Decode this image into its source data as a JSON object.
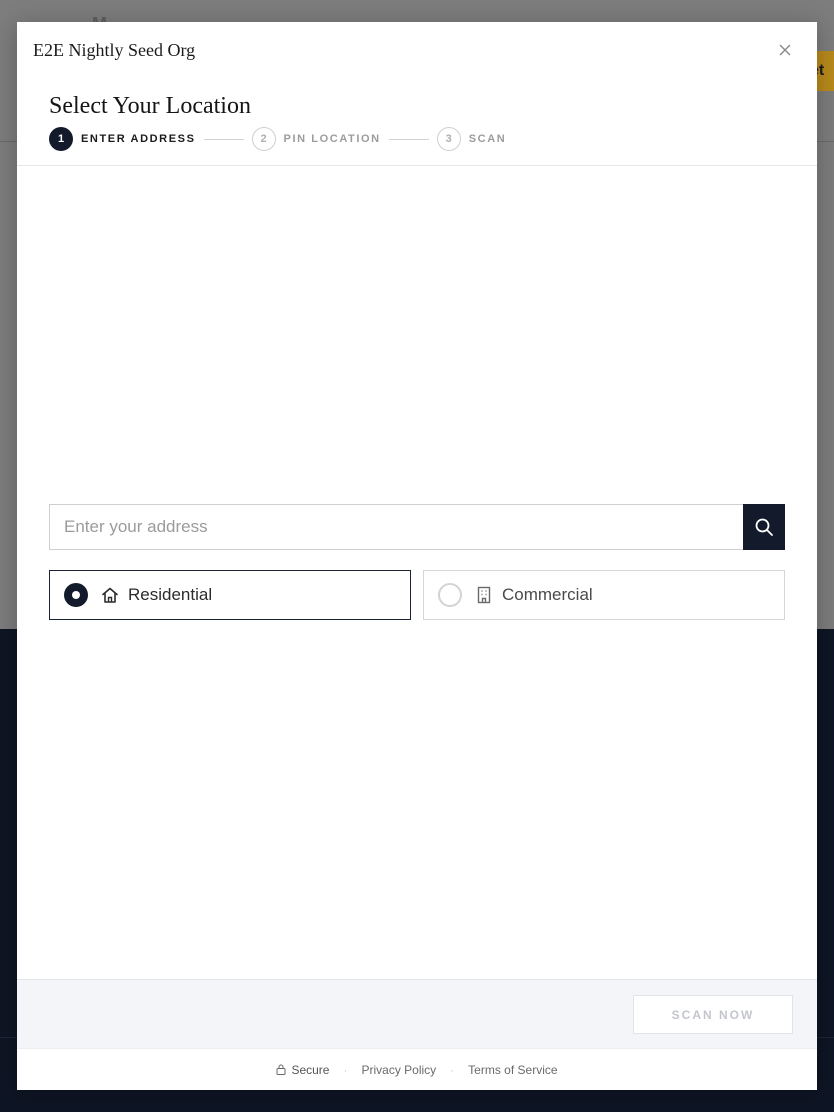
{
  "background": {
    "logo_text": "M",
    "cta_text": "et"
  },
  "modal": {
    "title": "E2E Nightly Seed Org",
    "close_icon": "close-icon",
    "section_title": "Select Your Location",
    "steps": [
      {
        "number": "1",
        "label": "Enter Address",
        "state": "active"
      },
      {
        "number": "2",
        "label": "Pin Location",
        "state": "inactive"
      },
      {
        "number": "3",
        "label": "Scan",
        "state": "inactive"
      }
    ],
    "address": {
      "value": "",
      "placeholder": "Enter your address",
      "search_icon": "search-icon"
    },
    "property_types": [
      {
        "label": "Residential",
        "icon": "home-icon",
        "selected": true
      },
      {
        "label": "Commercial",
        "icon": "building-icon",
        "selected": false
      }
    ],
    "scan_button": "Scan Now",
    "legal": {
      "secure": "Secure",
      "privacy": "Privacy Policy",
      "terms": "Terms of Service",
      "separator": "·"
    }
  },
  "colors": {
    "primary": "#121a2c",
    "overlay": "#7d7d7d",
    "accent_bg": "#b98a1c",
    "footer_bg": "#f4f5f8"
  }
}
